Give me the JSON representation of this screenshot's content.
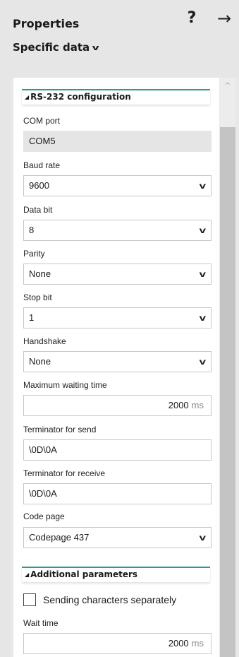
{
  "header": {
    "title": "Properties",
    "help_label": "?",
    "close_label": "→",
    "subtitle": "Specific data",
    "subtitle_chevron": "v"
  },
  "sections": {
    "rs232": {
      "title": "RS-232 configuration"
    },
    "additional": {
      "title": "Additional parameters"
    }
  },
  "fields": {
    "com_port": {
      "label": "COM port",
      "value": "COM5"
    },
    "baud_rate": {
      "label": "Baud rate",
      "value": "9600"
    },
    "data_bit": {
      "label": "Data bit",
      "value": "8"
    },
    "parity": {
      "label": "Parity",
      "value": "None"
    },
    "stop_bit": {
      "label": "Stop bit",
      "value": "1"
    },
    "handshake": {
      "label": "Handshake",
      "value": "None"
    },
    "max_wait": {
      "label": "Maximum waiting time",
      "value": "2000",
      "unit": "ms"
    },
    "term_send": {
      "label": "Terminator for send",
      "value": "\\0D\\0A"
    },
    "term_receive": {
      "label": "Terminator for receive",
      "value": "\\0D\\0A"
    },
    "code_page": {
      "label": "Code page",
      "value": "Codepage 437"
    },
    "send_separately": {
      "label": "Sending characters separately",
      "checked": false
    },
    "wait_time": {
      "label": "Wait time",
      "value": "2000",
      "unit": "ms"
    }
  },
  "icons": {
    "dropdown": "chevron-down-icon",
    "section_collapse": "triangle-icon",
    "scroll_up": "scroll-up-arrow-icon"
  },
  "colors": {
    "accent": "#2a9b8f",
    "readonly_bg": "#e5e5e5",
    "panel_bg": "#e6e6e6"
  }
}
